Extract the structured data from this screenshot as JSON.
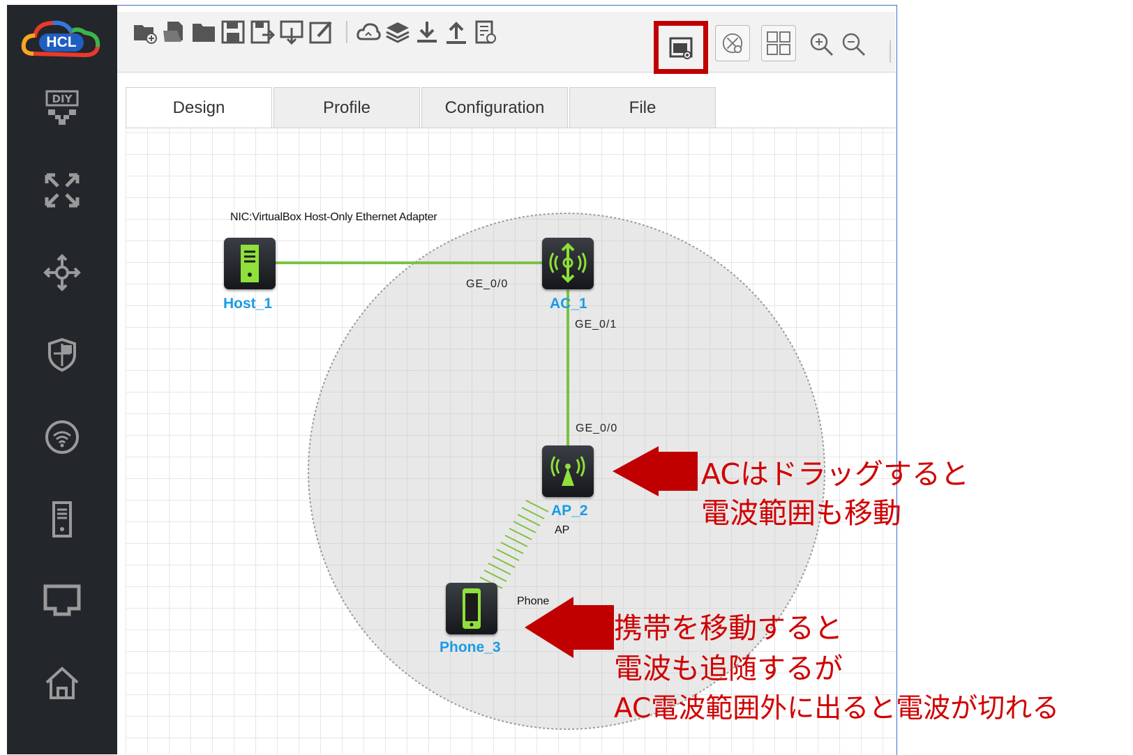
{
  "app": {
    "logo_text": "HCL"
  },
  "sidebar": {
    "items": [
      {
        "name": "diy-icon",
        "label": "DIY"
      },
      {
        "name": "switch-icon"
      },
      {
        "name": "router-icon"
      },
      {
        "name": "firewall-icon"
      },
      {
        "name": "wireless-icon"
      },
      {
        "name": "server-icon"
      },
      {
        "name": "terminal-icon"
      },
      {
        "name": "home-icon"
      }
    ]
  },
  "toolbar": {
    "buttons": [
      "new-project-icon",
      "open-file-icon",
      "open-folder-icon",
      "save-icon",
      "save-as-icon",
      "export-icon",
      "edit-icon",
      "cloud-icon",
      "layers-icon",
      "download-icon",
      "upload-icon",
      "log-icon",
      "show-coverage-icon",
      "topology-view-icon",
      "grid-icon",
      "zoom-in-icon",
      "zoom-out-icon"
    ],
    "highlighted": "show-coverage-icon",
    "highlight_color": "#c00000"
  },
  "tabs": [
    {
      "label": "Design",
      "active": true
    },
    {
      "label": "Profile",
      "active": false
    },
    {
      "label": "Configuration",
      "active": false
    },
    {
      "label": "File",
      "active": false
    }
  ],
  "topology": {
    "host": {
      "name": "Host_1",
      "nic_label": "NIC:VirtualBox Host-Only Ethernet Adapter"
    },
    "ac": {
      "name": "AC_1",
      "port_to_host": "GE_0/0",
      "port_to_ap": "GE_0/1"
    },
    "ap": {
      "name": "AP_2",
      "type_label": "AP",
      "port_to_ac": "GE_0/0"
    },
    "phone": {
      "name": "Phone_3",
      "type_label": "Phone"
    },
    "link_color": "#7cc242",
    "device_accent": "#8fe03a",
    "name_color": "#1a9be6"
  },
  "annotations": {
    "color": "#d00000",
    "ac_note": [
      "ACはドラッグすると",
      "電波範囲も移動"
    ],
    "phone_note": [
      "携帯を移動すると",
      "電波も追随するが",
      "AC電波範囲外に出ると電波が切れる"
    ]
  }
}
